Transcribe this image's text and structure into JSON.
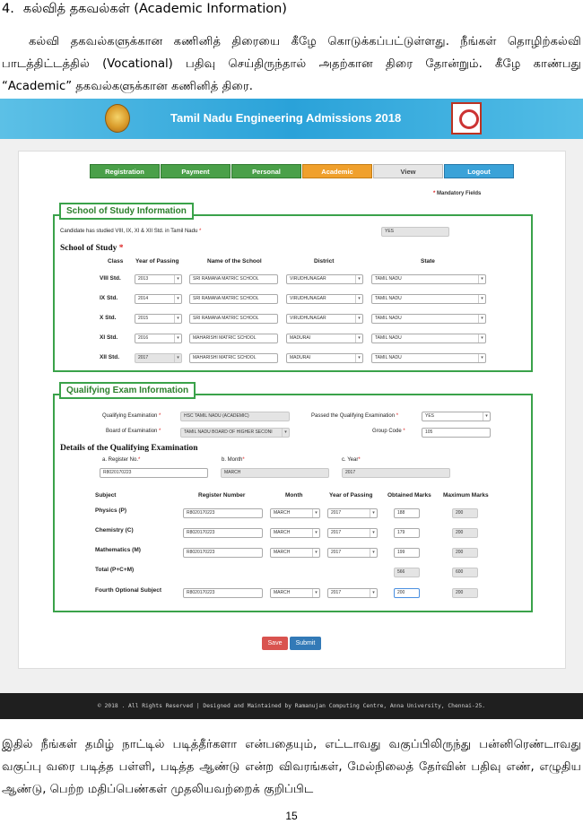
{
  "doc": {
    "heading_number": "4.",
    "heading": "கல்வித் தகவல்கள் (Academic Information)",
    "para_top": "கல்வி தகவல்களுக்கான கணினித் திரையை கீழே கொடுக்கப்பட்டுள்ளது. நீங்கள் தொழிற்கல்வி பாடத்திட்டத்தில் (Vocational) பதிவு செய்திருந்தால் அதற்கான திரை தோன்றும். கீழே காண்பது “Academic” தகவல்களுக்கான கணினித் திரை.",
    "para_bottom": "இதில் நீங்கள் தமிழ் நாட்டில் படித்தீர்களா என்பதையும், எட்டாவது வகுப்பிலிருந்து பன்னிரெண்டாவது வகுப்பு வரை படித்த பள்ளி, படித்த ஆண்டு என்ற விவரங்கள், மேல்நிலைத் தேர்வின் பதிவு எண், எழுதிய ஆண்டு, பெற்ற மதிப்பெண்கள் முதலியவற்றைக் குறிப்பிட",
    "page_number": "15"
  },
  "app": {
    "title": "Tamil Nadu Engineering Admissions 2018",
    "tabs": [
      "Registration",
      "Payment",
      "Personal",
      "Academic",
      "View",
      "Logout"
    ],
    "mandatory_note": "Mandatory Fields",
    "footer": "© 2018 . All Rights Reserved | Designed and Maintained by Ramanujan Computing Centre, Anna University, Chennai-25."
  },
  "school": {
    "title": "School of Study Information",
    "tn_question": "Candidate has studied VIII, IX, XI & XII Std. in Tamil Nadu",
    "tn_answer": "YES",
    "section": "School of Study",
    "headers": [
      "Class",
      "Year of Passing",
      "Name of the School",
      "District",
      "State"
    ],
    "rows": [
      {
        "class": "VIII Std.",
        "year": "2013",
        "school": "SRI RAMANA MATRIC SCHOOL",
        "district": "VIRUDHUNAGAR",
        "state": "TAMIL NADU"
      },
      {
        "class": "IX Std.",
        "year": "2014",
        "school": "SRI RAMANA MATRIC SCHOOL",
        "district": "VIRUDHUNAGAR",
        "state": "TAMIL NADU"
      },
      {
        "class": "X Std.",
        "year": "2015",
        "school": "SRI RAMANA MATRIC SCHOOL",
        "district": "VIRUDHUNAGAR",
        "state": "TAMIL NADU"
      },
      {
        "class": "XI Std.",
        "year": "2016",
        "school": "MAHARISHI MATRIC SCHOOL",
        "district": "MADURAI",
        "state": "TAMIL NADU"
      },
      {
        "class": "XII Std.",
        "year": "2017",
        "school": "MAHARISHI MATRIC SCHOOL",
        "district": "MADURAI",
        "state": "TAMIL NADU"
      }
    ]
  },
  "exam": {
    "title": "Qualifying Exam Information",
    "qual_label": "Qualifying Examination",
    "qual_value": "HSC TAMIL NADU (ACADEMIC)",
    "passed_label": "Passed the Qualifying Examination",
    "passed_value": "YES",
    "board_label": "Board of Examination",
    "board_value": "TAMIL NADU BOARD OF HIGHER SECONI",
    "group_label": "Group Code",
    "group_value": "105",
    "details_title": "Details of the Qualifying Examination",
    "reg_label": "a. Register No.",
    "reg_value": "R8020170223",
    "month_label": "b. Month",
    "month_value": "MARCH",
    "year_label": "c. Year",
    "year_value": "2017",
    "headers": [
      "Subject",
      "Register Number",
      "Month",
      "Year of Passing",
      "Obtained Marks",
      "Maximum Marks"
    ],
    "subjects": [
      {
        "name": "Physics (P)",
        "reg": "R8020170223",
        "month": "MARCH",
        "year": "2017",
        "obtained": "188",
        "max": "200"
      },
      {
        "name": "Chemistry (C)",
        "reg": "R8020170223",
        "month": "MARCH",
        "year": "2017",
        "obtained": "179",
        "max": "200"
      },
      {
        "name": "Mathematics (M)",
        "reg": "R8020170223",
        "month": "MARCH",
        "year": "2017",
        "obtained": "199",
        "max": "200"
      }
    ],
    "total_label": "Total (P+C+M)",
    "total_obtained": "566",
    "total_max": "600",
    "fourth": {
      "name": "Fourth Optional Subject",
      "reg": "R8020170223",
      "month": "MARCH",
      "year": "2017",
      "obtained": "200",
      "max": "200"
    },
    "save": "Save",
    "submit": "Submit"
  }
}
